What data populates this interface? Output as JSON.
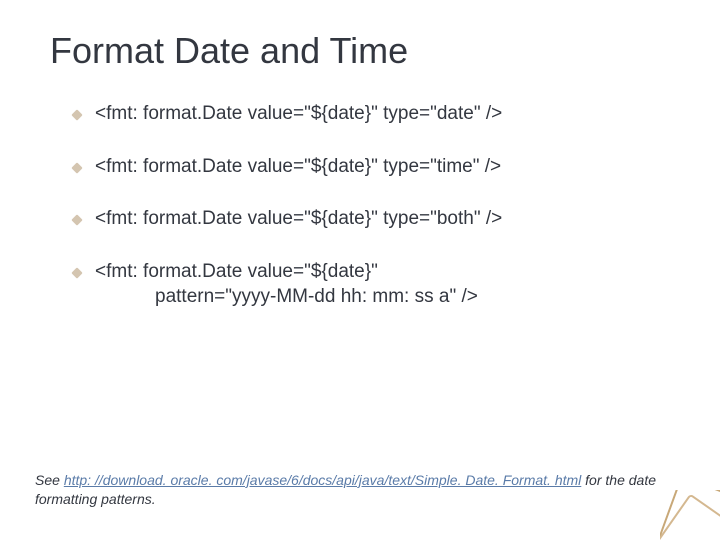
{
  "title": "Format Date and Time",
  "code_lines": [
    "<fmt: format.Date value=\"${date}\" type=\"date\" />",
    "<fmt: format.Date value=\"${date}\" type=\"time\" />",
    "<fmt: format.Date value=\"${date}\" type=\"both\" />"
  ],
  "code_multi": {
    "line1": "<fmt: format.Date value=\"${date}\"",
    "line2": "pattern=\"yyyy-MM-dd hh: mm: ss a\" />"
  },
  "footer": {
    "prefix": "See ",
    "link_text": "http: //download. oracle. com/javase/6/docs/api/java/text/Simple. Date. Format. html",
    "suffix": " for the date formatting patterns."
  }
}
